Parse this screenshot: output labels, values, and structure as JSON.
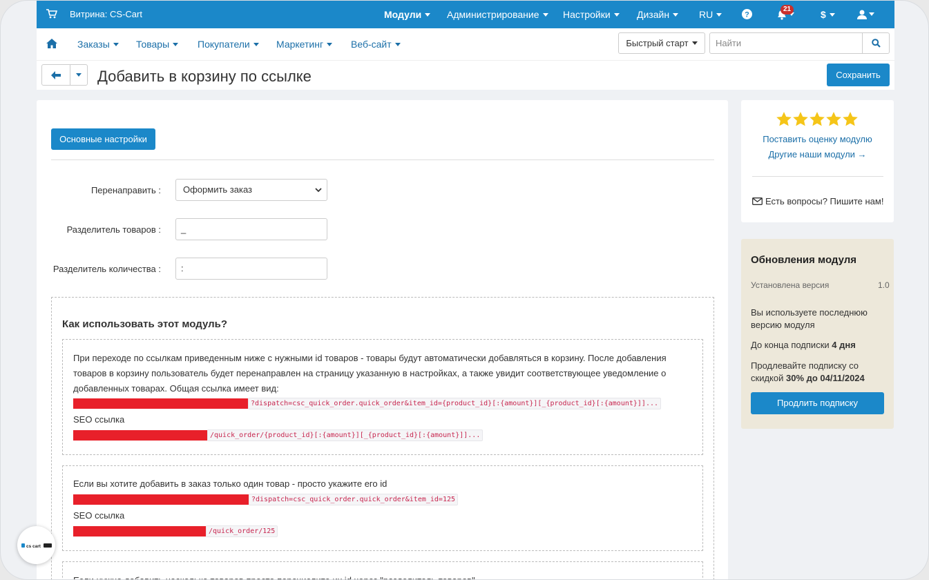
{
  "header": {
    "store_label": "Витрина: CS-Cart",
    "nav": [
      "Модули",
      "Администрирование",
      "Настройки",
      "Дизайн",
      "RU"
    ],
    "notifications_count": "21",
    "currency": "$"
  },
  "subnav": {
    "items": [
      "Заказы",
      "Товары",
      "Покупатели",
      "Маркетинг",
      "Веб-сайт"
    ],
    "quick_start": "Быстрый старт",
    "search_placeholder": "Найти"
  },
  "page": {
    "title": "Добавить в корзину по ссылке",
    "save_label": "Сохранить"
  },
  "tabs": {
    "active": "Основные настройки"
  },
  "form": {
    "redirect_label": "Перенаправить :",
    "redirect_value": "Оформить заказ",
    "product_sep_label": "Разделитель товаров :",
    "product_sep_value": "_",
    "qty_sep_label": "Разделитель количества :",
    "qty_sep_value": ":"
  },
  "howto": {
    "title": "Как использовать этот модуль?",
    "box1": {
      "text": "При переходе по ссылкам приведенным ниже с нужными id товаров - товары будут автоматически добавляться в корзину. После добавления товаров в корзину пользователь будет перенаправлен на страницу указанную в настройках, а также увидит соответствующее уведомление о добавленных товарах. Общая ссылка имеет вид:",
      "code1": "?dispatch=csc_quick_order.quick_order&item_id={product_id}[:{amount}][_{product_id}[:{amount}]]...",
      "seo_label": "SEO ссылка",
      "code2": "/quick_order/{product_id}[:{amount}][_{product_id}[:{amount}]]..."
    },
    "box2": {
      "text": "Если вы хотите добавить в заказ только один товар - просто укажите его id",
      "code1": "?dispatch=csc_quick_order.quick_order&item_id=125",
      "seo_label": "SEO ссылка",
      "code2": "/quick_order/125"
    },
    "box3": {
      "text": "Если нужно добавить несколько товаров просто перечислите их id через \"разделитель товаров\""
    }
  },
  "rating_panel": {
    "rate_link": "Поставить оценку модулю",
    "other_link": "Другие наши модули →",
    "contact": "Есть вопросы? Пишите нам!",
    "stars": 5,
    "star_color": "#f5c518"
  },
  "updates_panel": {
    "title": "Обновления модуля",
    "installed_label": "Установлена версия",
    "installed_version": "1.0",
    "latest_text": "Вы используете последнюю версию модуля",
    "subscription_prefix": "До конца подписки ",
    "subscription_days": "4 дня",
    "renew_text_prefix": "Продлевайте подписку со скидкой ",
    "renew_text_bold": "30% до 04/11/2024",
    "renew_button": "Продлить подписку"
  },
  "floating_logo": {
    "text": "cs cart"
  },
  "colors": {
    "primary": "#1b88c9",
    "link": "#1b6fa8",
    "redaction": "#e8202a",
    "code_text": "#c7254e",
    "updates_bg": "#ede8da"
  }
}
